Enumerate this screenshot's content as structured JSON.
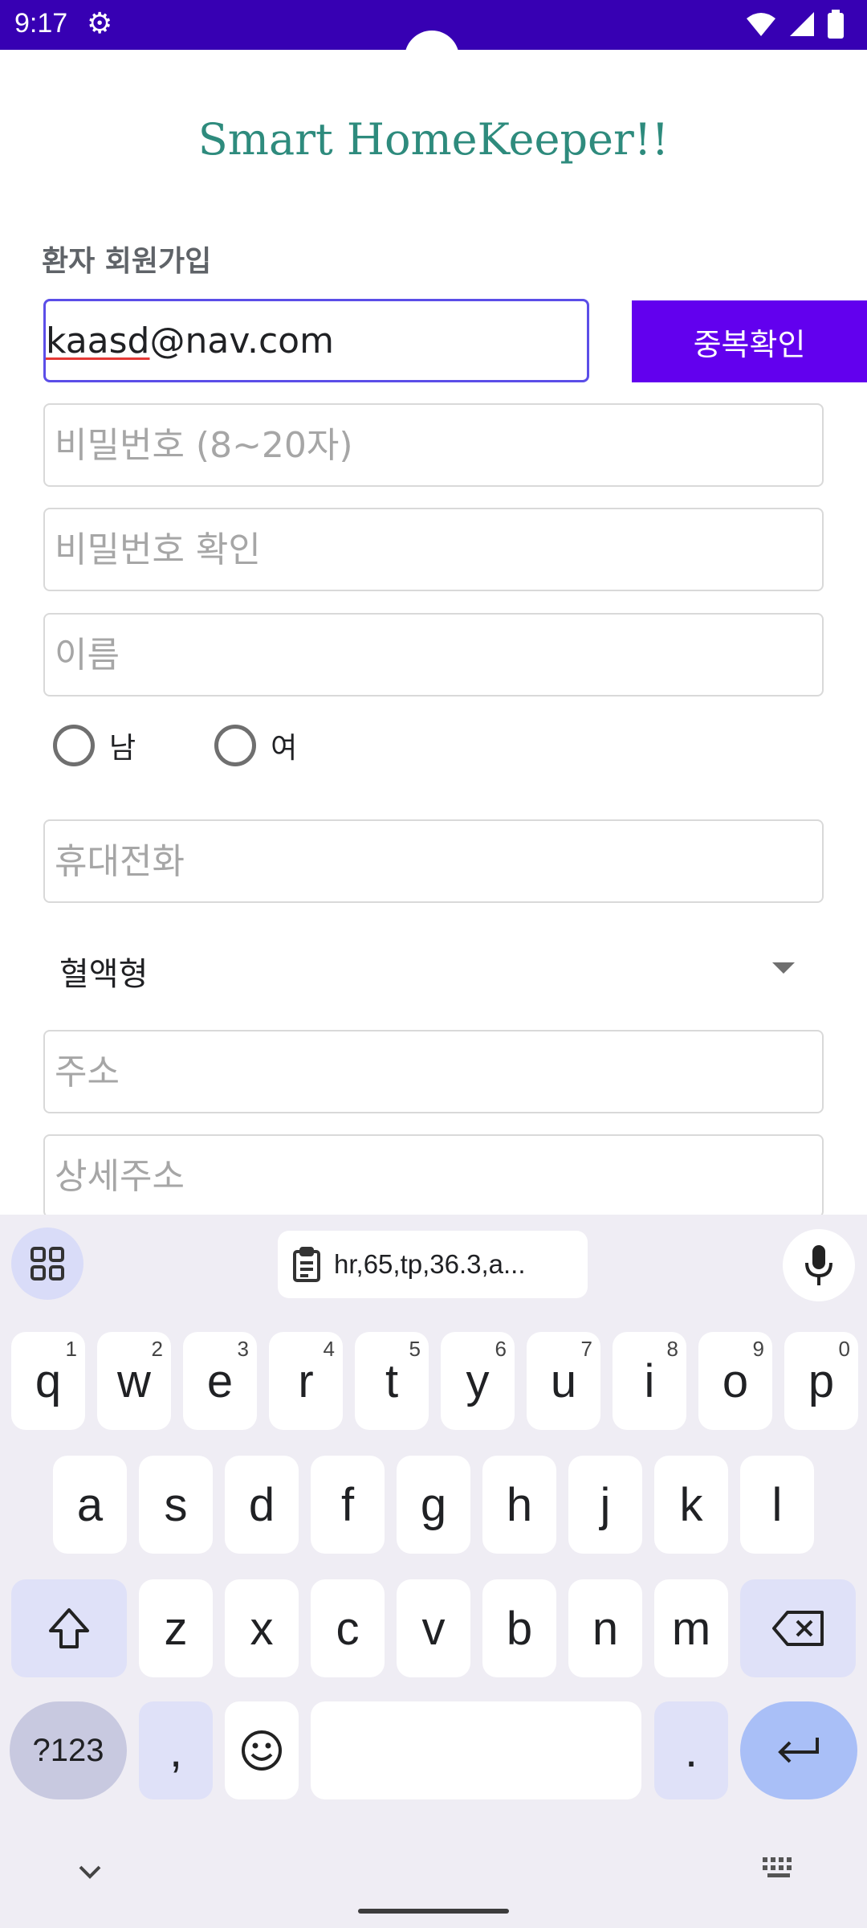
{
  "status": {
    "time": "9:17",
    "icons": [
      "settings-icon",
      "wifi-icon",
      "signal-icon",
      "battery-icon"
    ]
  },
  "app": {
    "title": "Smart HomeKeeper!!"
  },
  "form": {
    "section_label": "환자 회원가입",
    "email_value_prefix": "kaasd",
    "email_value_suffix": "@nav.com",
    "dup_button": "중복확인",
    "password_placeholder": "비밀번호 (8~20자)",
    "password_confirm_placeholder": "비밀번호 확인",
    "name_placeholder": "이름",
    "gender_male": "남",
    "gender_female": "여",
    "phone_placeholder": "휴대전화",
    "blood_type_value": "혈액형",
    "address_placeholder": "주소",
    "address_detail_placeholder": "상세주소"
  },
  "keyboard": {
    "clipboard_text": "hr,65,tp,36.3,a...",
    "row1": [
      "q",
      "w",
      "e",
      "r",
      "t",
      "y",
      "u",
      "i",
      "o",
      "p"
    ],
    "row1_hints": [
      "1",
      "2",
      "3",
      "4",
      "5",
      "6",
      "7",
      "8",
      "9",
      "0"
    ],
    "row2": [
      "a",
      "s",
      "d",
      "f",
      "g",
      "h",
      "j",
      "k",
      "l"
    ],
    "row3": [
      "z",
      "x",
      "c",
      "v",
      "b",
      "n",
      "m"
    ],
    "num_key": "?123",
    "comma_key": ",",
    "period_key": "."
  },
  "colors": {
    "status_bar": "#3700b3",
    "accent": "#6200ee",
    "title": "#2e8b7d",
    "focus_border": "#5b4ee8"
  }
}
